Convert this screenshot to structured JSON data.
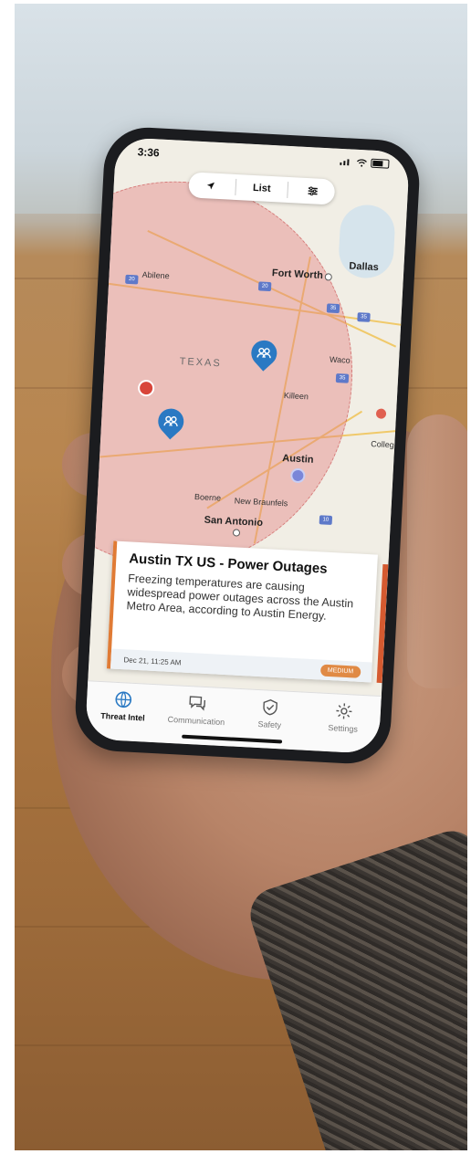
{
  "status_bar": {
    "time": "3:36"
  },
  "toolbar": {
    "location_icon": "location-arrow-icon",
    "list_label": "List",
    "filter_icon": "filter-icon"
  },
  "map": {
    "labels": {
      "fort_worth": "Fort Worth",
      "dallas": "Dallas",
      "abilene": "Abilene",
      "texas": "TEXAS",
      "waco": "Waco",
      "killeen": "Killeen",
      "college": "College",
      "austin": "Austin",
      "new_braunfels": "New Braunfels",
      "boerne": "Boerne",
      "san_antonio": "San Antonio"
    },
    "colors": {
      "radius": "#e27e7e",
      "pin": "#2a79c3",
      "alert_dot": "#d8453a"
    }
  },
  "alert": {
    "title": "Austin TX US - Power Outages",
    "body": "Freezing temperatures are causing widespread power outages across the Austin Metro Area, according to Austin Energy.",
    "date": "Dec 21, 11:25 AM",
    "severity": "MEDIUM",
    "accent_color": "#e07b35"
  },
  "nav": {
    "items": [
      {
        "label": "Threat Intel",
        "icon": "globe-icon",
        "active": true
      },
      {
        "label": "Communication",
        "icon": "chat-icon",
        "active": false
      },
      {
        "label": "Safety",
        "icon": "shield-check-icon",
        "active": false
      },
      {
        "label": "Settings",
        "icon": "gear-icon",
        "active": false
      }
    ]
  }
}
